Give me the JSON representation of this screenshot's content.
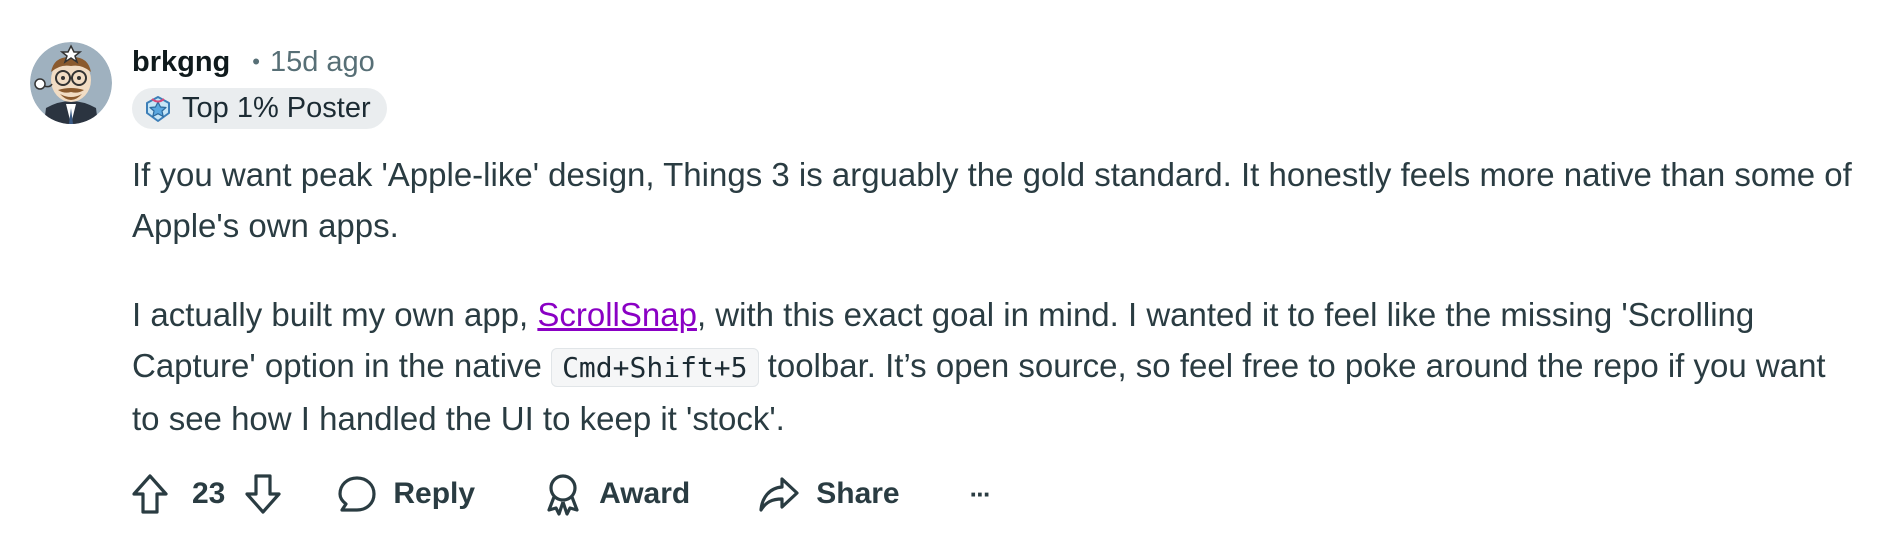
{
  "comment": {
    "author": {
      "username": "brkgng",
      "timestamp": "15d ago",
      "separator": "•",
      "avatar": "cartoon-avatar-icon",
      "flair": {
        "label": "Top 1% Poster",
        "icon": "poster-badge-icon"
      }
    },
    "body": {
      "paragraph1": "If you want peak 'Apple-like' design, Things 3 is arguably the gold standard. It honestly feels more native than some of Apple's own apps.",
      "paragraph2": {
        "before_link": "I actually built my own app, ",
        "link_text": "ScrollSnap",
        "after_link": ", with this exact goal in mind. I wanted it to feel like the missing 'Scrolling Capture' option in the native ",
        "code_text": "Cmd+Shift+5",
        "after_code": " toolbar. It’s open source, so feel free to poke around the repo if you want to see how I handled the UI to keep it 'stock'."
      }
    },
    "actions": {
      "vote_count": "23",
      "reply_label": "Reply",
      "award_label": "Award",
      "share_label": "Share",
      "more_label": "···"
    }
  },
  "colors": {
    "link": "#8a00c4",
    "text": "#2a3c42",
    "muted": "#576f76",
    "flair_bg": "#eaedef"
  }
}
